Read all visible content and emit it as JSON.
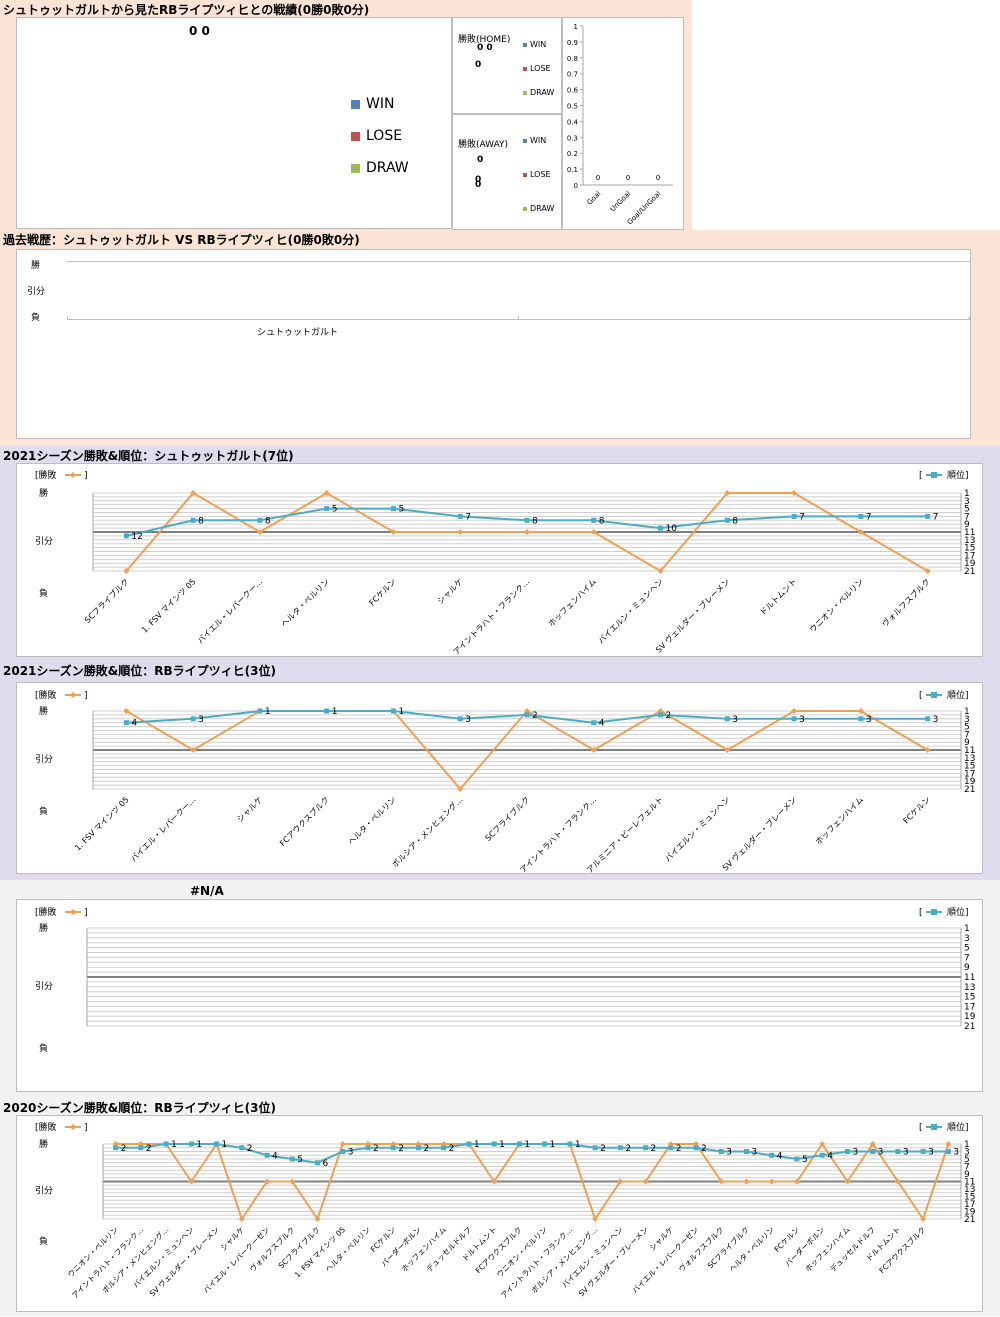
{
  "sec1": {
    "title": "シュトゥットガルトから見たRBライプツィヒとの戦績(0勝0敗0分)",
    "pie_value": "0 0",
    "legend": [
      "WIN",
      "LOSE",
      "DRAW"
    ],
    "home": {
      "title": "勝敗(HOME)",
      "v1": "0 0",
      "v2": "0",
      "legend": [
        "WIN",
        "LOSE",
        "DRAW"
      ]
    },
    "away": {
      "title": "勝敗(AWAY)",
      "v1": "0",
      "v2": "0",
      "v3": "0",
      "legend": [
        "WIN",
        "LOSE",
        "DRAW"
      ]
    }
  },
  "sec2": {
    "title": "過去戦歴：シュトゥットガルト VS RBライプツィヒ(0勝0敗0分)",
    "y_labels": [
      "勝",
      "引分",
      "負"
    ],
    "x_label": "シュトゥットガルト"
  },
  "legend_text": {
    "result": "[勝敗",
    "bracket_close": "]",
    "rank_open": "[",
    "rank": "順位]"
  },
  "chart_data": [
    {
      "type": "bar",
      "categories": [
        "Goal",
        "UnGoal",
        "Goal/UnGoal"
      ],
      "values": [
        0,
        0,
        0
      ],
      "data_labels": [
        "0",
        "0",
        "0"
      ],
      "ylim": [
        0,
        1
      ],
      "yticks": [
        "0",
        "0.1",
        "0.2",
        "0.3",
        "0.4",
        "0.5",
        "0.6",
        "0.7",
        "0.8",
        "0.9",
        "1"
      ]
    },
    {
      "type": "line",
      "title": "2021シーズン勝敗&順位：シュトゥットガルト(7位)",
      "y_left_labels": [
        "勝",
        "引分",
        "負"
      ],
      "y_right_ticks": [
        "1",
        "3",
        "5",
        "7",
        "9",
        "11",
        "13",
        "15",
        "17",
        "19",
        "21"
      ],
      "categories": [
        "SCフライブルク",
        "1. FSV マインツ 05",
        "バイエル・レバークー…",
        "ヘルタ・ベルリン",
        "FCケルン",
        "シャルケ",
        "アイントラハト・フランク…",
        "ホッフェンハイム",
        "バイエルン・ミュンヘン",
        "SV ヴェルダー・ブレーメン",
        "ドルトムント",
        "ウニオン・ベルリン",
        "ヴォルフスブルク"
      ],
      "series": [
        {
          "name": "勝敗",
          "values": [
            -1,
            1,
            0,
            1,
            0,
            0,
            0,
            0,
            -1,
            1,
            1,
            0,
            -1
          ]
        },
        {
          "name": "順位",
          "values": [
            12,
            8,
            8,
            5,
            5,
            7,
            8,
            8,
            10,
            8,
            7,
            7,
            7
          ]
        }
      ]
    },
    {
      "type": "line",
      "title": "2021シーズン勝敗&順位：RBライプツィヒ(3位)",
      "y_left_labels": [
        "勝",
        "引分",
        "負"
      ],
      "y_right_ticks": [
        "1",
        "3",
        "5",
        "7",
        "9",
        "11",
        "13",
        "15",
        "17",
        "19",
        "21"
      ],
      "categories": [
        "1. FSV マインツ 05",
        "バイエル・レバークー…",
        "シャルケ",
        "FCアウクスブルク",
        "ヘルタ・ベルリン",
        "ボルシア・メンヒェング…",
        "SCフライブルク",
        "アイントラハト・フランク…",
        "アルミニア・ビーレフェルト",
        "バイエルン・ミュンヘン",
        "SV ヴェルダー・ブレーメン",
        "ホッフェンハイム",
        "FCケルン"
      ],
      "series": [
        {
          "name": "勝敗",
          "values": [
            1,
            0,
            1,
            1,
            1,
            -1,
            1,
            0,
            1,
            0,
            1,
            1,
            0
          ]
        },
        {
          "name": "順位",
          "values": [
            4,
            3,
            1,
            1,
            1,
            3,
            2,
            4,
            2,
            3,
            3,
            3,
            3
          ]
        }
      ]
    },
    {
      "type": "line",
      "title": "#N/A",
      "y_left_labels": [
        "勝",
        "引分",
        "負"
      ],
      "y_right_ticks": [
        "1",
        "3",
        "5",
        "7",
        "9",
        "11",
        "13",
        "15",
        "17",
        "19",
        "21"
      ],
      "categories": [],
      "series": [
        {
          "name": "勝敗",
          "values": []
        },
        {
          "name": "順位",
          "values": []
        }
      ]
    },
    {
      "type": "line",
      "title": "2020シーズン勝敗&順位：RBライプツィヒ(3位)",
      "y_left_labels": [
        "勝",
        "引分",
        "負"
      ],
      "y_right_ticks": [
        "1",
        "3",
        "5",
        "7",
        "9",
        "11",
        "13",
        "15",
        "17",
        "19",
        "21"
      ],
      "categories": [
        "ウニオン・ベルリン",
        "アイントラハト・フランク…",
        "ボルシア・メンヒェング…",
        "バイエルン・ミュンヘン",
        "SV ヴェルダー・ブレーメン",
        "シャルケ",
        "バイエル・レバークーゼン",
        "ヴォルフスブルク",
        "SCフライブルク",
        "1. FSV マインツ 05",
        "ヘルタ・ベルリン",
        "FCケルン",
        "パーダーボルン",
        "ホッフェンハイム",
        "デュッセルドルフ",
        "ドルトムント",
        "FCアウクスブルク",
        "ウニオン・ベルリン",
        "アイントラハト・フランク…",
        "ボルシア・メンヒェング…",
        "バイエルン・ミュンヘン",
        "SV ヴェルダー・ブレーメン",
        "シャルケ",
        "バイエル・レバークーゼン",
        "ヴォルフスブルク",
        "SCフライブルク",
        "ヘルタ・ベルリン",
        "FCケルン",
        "パーダーボルン",
        "ホッフェンハイム",
        "デュッセルドルフ",
        "ドルトムント",
        "FCアウクスブルク"
      ],
      "series": [
        {
          "name": "勝敗",
          "values": [
            1,
            1,
            1,
            0,
            1,
            -1,
            0,
            0,
            -1,
            1,
            1,
            1,
            1,
            1,
            1,
            0,
            1,
            1,
            1,
            -1,
            0,
            0,
            1,
            1,
            0,
            0,
            0,
            0,
            1,
            0,
            1,
            0,
            -1,
            1
          ]
        },
        {
          "name": "順位",
          "values": [
            2,
            2,
            1,
            1,
            1,
            2,
            4,
            5,
            6,
            3,
            2,
            2,
            2,
            2,
            1,
            1,
            1,
            1,
            1,
            2,
            2,
            2,
            2,
            2,
            3,
            3,
            4,
            5,
            4,
            3,
            3,
            3,
            3,
            3
          ]
        }
      ]
    }
  ],
  "colors": {
    "result": "#f0a050",
    "rank": "#4bacc6",
    "win": "#4f81bd",
    "lose": "#c0504d",
    "draw": "#9bbb59",
    "bg_pink": "#fbe4d5",
    "bg_purple": "#e0dced",
    "bg_grey": "#f2f2f2"
  }
}
